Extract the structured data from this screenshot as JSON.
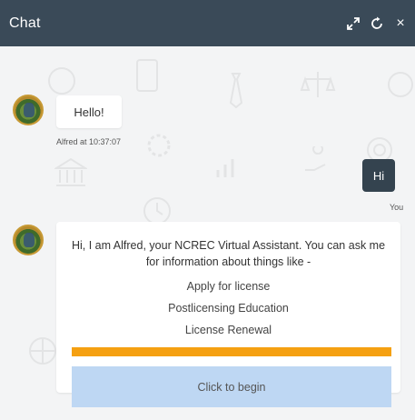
{
  "header": {
    "title": "Chat",
    "icons": [
      "expand-icon",
      "refresh-icon",
      "close-icon"
    ],
    "close_glyph": "×"
  },
  "colors": {
    "header_bg": "#3a4a58",
    "user_bubble_bg": "#34434f",
    "accent_bar": "#f5a011",
    "begin_button_bg": "#bed7f3"
  },
  "messages": {
    "bot_greeting": {
      "text": "Hello!",
      "meta": "Alfred at 10:37:07"
    },
    "user_reply": {
      "text": "Hi",
      "meta": "You"
    },
    "bot_intro": {
      "text": "Hi, I am Alfred, your NCREC Virtual Assistant. You can ask me for information about things like -",
      "options": [
        "Apply for license",
        "Postlicensing Education",
        "License Renewal"
      ],
      "button_label": "Click to begin"
    }
  }
}
